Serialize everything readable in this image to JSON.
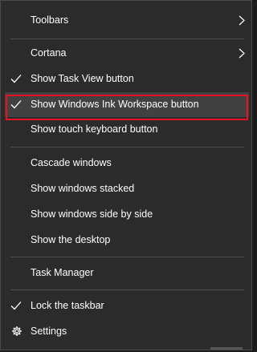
{
  "menu": {
    "items": [
      {
        "label": "Toolbars",
        "submenu": true,
        "checked": false
      },
      {
        "label": "Cortana",
        "submenu": true,
        "checked": false
      },
      {
        "label": "Show Task View button",
        "submenu": false,
        "checked": true
      },
      {
        "label": "Show Windows Ink Workspace button",
        "submenu": false,
        "checked": true,
        "hover": true,
        "highlighted": true
      },
      {
        "label": "Show touch keyboard button",
        "submenu": false,
        "checked": false
      },
      {
        "label": "Cascade windows",
        "submenu": false,
        "checked": false
      },
      {
        "label": "Show windows stacked",
        "submenu": false,
        "checked": false
      },
      {
        "label": "Show windows side by side",
        "submenu": false,
        "checked": false
      },
      {
        "label": "Show the desktop",
        "submenu": false,
        "checked": false
      },
      {
        "label": "Task Manager",
        "submenu": false,
        "checked": false
      },
      {
        "label": "Lock the taskbar",
        "submenu": false,
        "checked": true
      },
      {
        "label": "Settings",
        "submenu": false,
        "checked": false,
        "icon": "gear-icon"
      }
    ]
  },
  "colors": {
    "menu_background": "#2b2b2b",
    "hover_background": "#414141",
    "text": "#ffffff",
    "separator": "#4d4d4d",
    "highlight_border": "#e81123"
  }
}
